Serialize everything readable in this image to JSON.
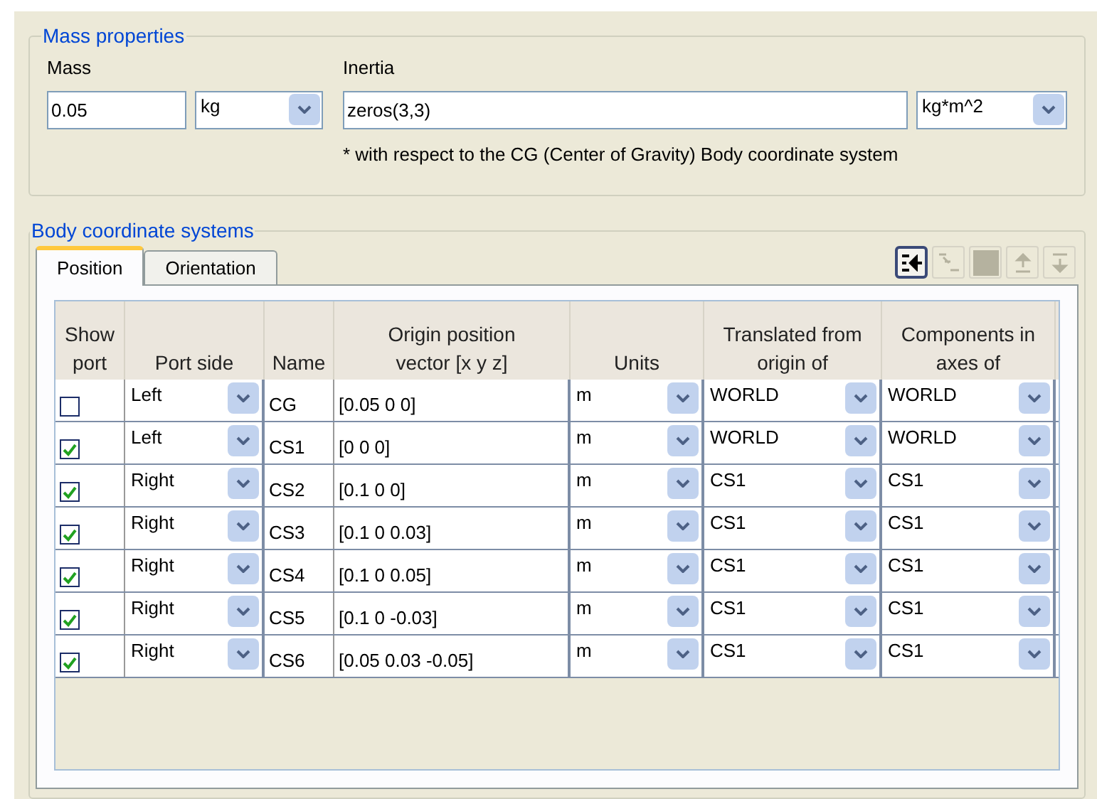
{
  "mass_properties": {
    "title": "Mass properties",
    "mass": {
      "label": "Mass",
      "value": "0.05",
      "unit": "kg"
    },
    "inertia": {
      "label": "Inertia",
      "value": "zeros(3,3)",
      "unit": "kg*m^2",
      "note": "* with respect to the CG (Center of Gravity) Body coordinate system"
    }
  },
  "body_coordinate_systems": {
    "title": "Body coordinate systems",
    "tabs": [
      {
        "label": "Position",
        "selected": true
      },
      {
        "label": "Orientation",
        "selected": false
      }
    ],
    "toolbar": [
      {
        "kind": "insert",
        "disabled": false
      },
      {
        "kind": "outdent",
        "disabled": true
      },
      {
        "kind": "square",
        "disabled": true
      },
      {
        "kind": "up",
        "disabled": true
      },
      {
        "kind": "down",
        "disabled": true
      }
    ],
    "table": {
      "columns": [
        [
          "Show",
          "port"
        ],
        [
          "Port side"
        ],
        [
          "Name"
        ],
        [
          "Origin position",
          "vector [x y z]"
        ],
        [
          "Units"
        ],
        [
          "Translated from",
          "origin of"
        ],
        [
          "Components in",
          "axes of"
        ]
      ],
      "rows": [
        {
          "show_port": false,
          "port_side": "Left",
          "name": "CG",
          "origin": "[0.05 0 0]",
          "units": "m",
          "translated_from": "WORLD",
          "components_in": "WORLD"
        },
        {
          "show_port": true,
          "port_side": "Left",
          "name": "CS1",
          "origin": "[0 0 0]",
          "units": "m",
          "translated_from": "WORLD",
          "components_in": "WORLD"
        },
        {
          "show_port": true,
          "port_side": "Right",
          "name": "CS2",
          "origin": "[0.1 0 0]",
          "units": "m",
          "translated_from": "CS1",
          "components_in": "CS1"
        },
        {
          "show_port": true,
          "port_side": "Right",
          "name": "CS3",
          "origin": "[0.1 0 0.03]",
          "units": "m",
          "translated_from": "CS1",
          "components_in": "CS1"
        },
        {
          "show_port": true,
          "port_side": "Right",
          "name": "CS4",
          "origin": "[0.1 0 0.05]",
          "units": "m",
          "translated_from": "CS1",
          "components_in": "CS1"
        },
        {
          "show_port": true,
          "port_side": "Right",
          "name": "CS5",
          "origin": "[0.1 0 -0.03]",
          "units": "m",
          "translated_from": "CS1",
          "components_in": "CS1"
        },
        {
          "show_port": true,
          "port_side": "Right",
          "name": "CS6",
          "origin": "[0.05 0.03 -0.05]",
          "units": "m",
          "translated_from": "CS1",
          "components_in": "CS1"
        }
      ]
    }
  }
}
